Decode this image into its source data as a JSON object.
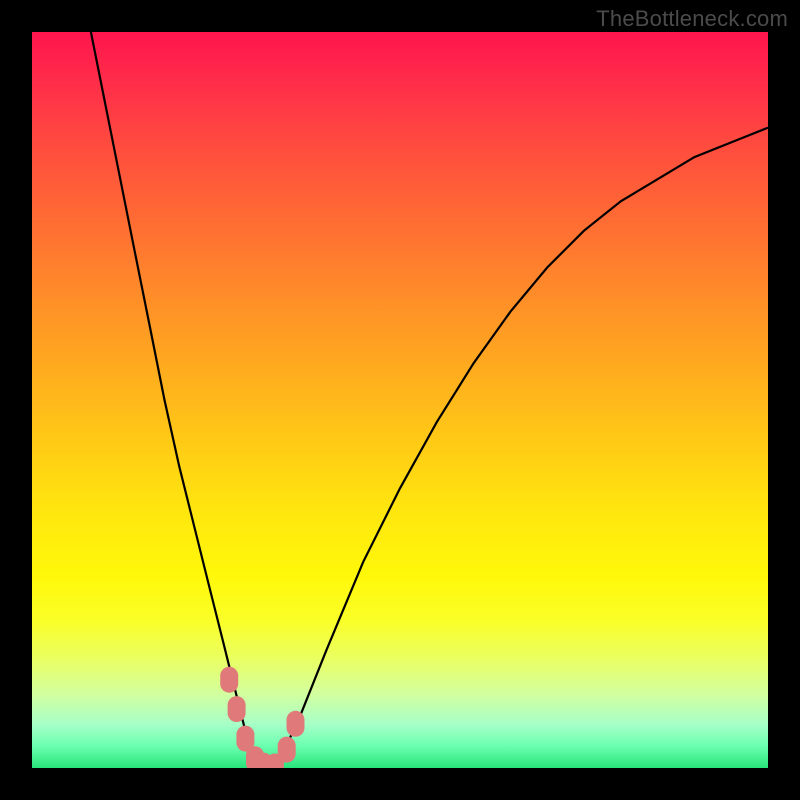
{
  "watermark": "TheBottleneck.com",
  "chart_data": {
    "type": "line",
    "title": "",
    "xlabel": "",
    "ylabel": "",
    "xlim": [
      0,
      100
    ],
    "ylim": [
      0,
      100
    ],
    "grid": false,
    "legend": false,
    "series": [
      {
        "name": "bottleneck-curve",
        "x": [
          8,
          10,
          12,
          14,
          16,
          18,
          20,
          22,
          24,
          26,
          27,
          28,
          29,
          30,
          31,
          32,
          34,
          36,
          40,
          45,
          50,
          55,
          60,
          65,
          70,
          75,
          80,
          85,
          90,
          95,
          100
        ],
        "values": [
          100,
          90,
          80,
          70,
          60,
          50,
          41,
          33,
          25,
          17,
          13,
          9,
          5,
          2,
          0.5,
          0,
          2,
          6,
          16,
          28,
          38,
          47,
          55,
          62,
          68,
          73,
          77,
          80,
          83,
          85,
          87
        ]
      }
    ],
    "markers": {
      "name": "highlight-points",
      "color": "#e07a7a",
      "x": [
        26.8,
        27.8,
        29.0,
        30.3,
        31.5,
        33.0,
        34.6,
        35.8
      ],
      "values": [
        12.0,
        8.0,
        4.0,
        1.2,
        0.3,
        0.2,
        2.5,
        6.0
      ]
    },
    "annotations": []
  }
}
